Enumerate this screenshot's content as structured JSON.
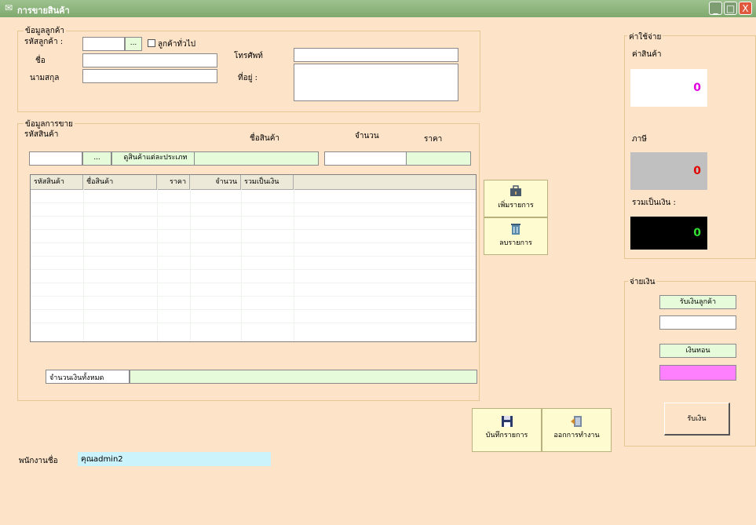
{
  "window": {
    "title": "การขายสินค้า",
    "min": "_",
    "max": "□",
    "close": "X"
  },
  "customer": {
    "section_title": "ข้อมูลลูกค้า",
    "id_label": "รหัสลูกค้า :",
    "browse": "...",
    "general_label": "ลูกค้าทั่วไป",
    "name_label": "ชื่อ",
    "surname_label": "นามสกุล",
    "phone_label": "โทรศัพท์",
    "address_label": "ที่อยู่ :"
  },
  "sale": {
    "section_title": "ข้อมูลการขาย",
    "product_id_label": "รหัสสินค้า",
    "product_name_label": "ชื่อสินค้า",
    "qty_label": "จำนวน",
    "price_label": "ราคา",
    "browse": "...",
    "view_by_type": "ดูสินค้าแต่ละประเภท",
    "columns": [
      "รหัสสินค้า",
      "ชื่อสินค้า",
      "ราคา",
      "จำนวน",
      "รวมเป็นเงิน"
    ],
    "add_item": "เพิ่มรายการ",
    "delete_item": "ลบรายการ",
    "total_label": "จำนวนเงินทั้งหมด"
  },
  "expense": {
    "section_title": "ค่าใช้จ่าย",
    "product_cost_label": "ค่าสินค้า",
    "product_cost_value": "0",
    "tax_label": "ภาษี",
    "tax_value": "0",
    "sum_label": "รวมเป็นเงิน :",
    "sum_value": "0"
  },
  "payment": {
    "section_title": "จ่ายเงิน",
    "receive_label": "รับเงินลูกค้า",
    "change_label": "เงินทอน",
    "receive_button": "รับเงิน"
  },
  "footer": {
    "save": "บันทึกรายการ",
    "exit": "ออกการทำงาน",
    "employee_label": "พนักงานชื่อ",
    "employee_value": "คุณadmin2"
  },
  "colors": {
    "pink_value": "#e000e0",
    "red_value": "#e00000",
    "green_value": "#33dd33"
  }
}
